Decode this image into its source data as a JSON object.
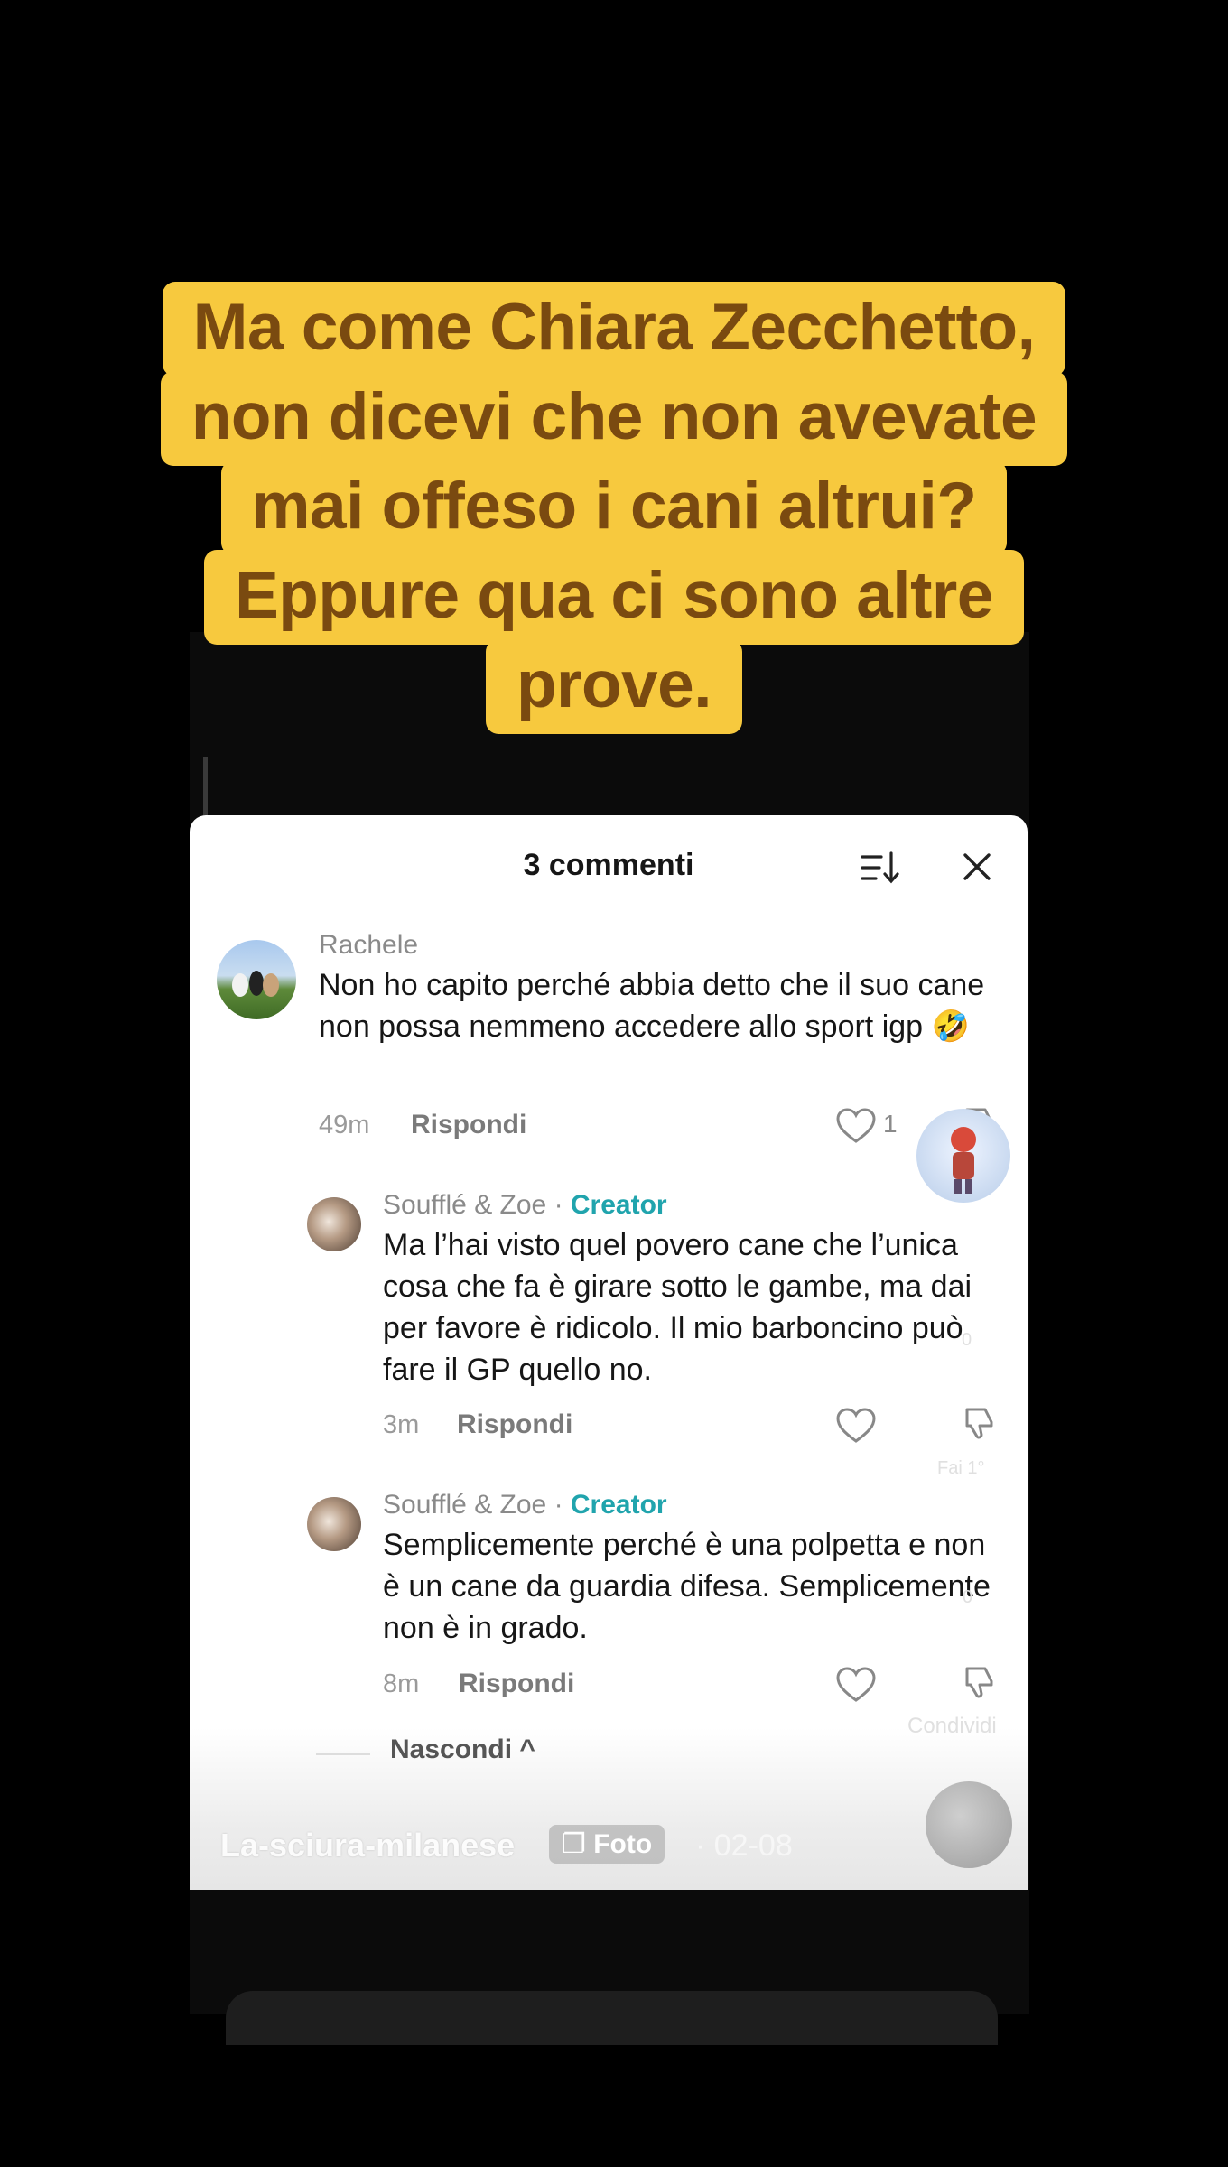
{
  "caption": {
    "lines": [
      "Ma come Chiara Zecchetto,",
      "non dicevi che non avevate",
      "mai offeso i cani altrui?",
      "Eppure qua ci sono altre",
      "prove."
    ]
  },
  "panel": {
    "title": "3 commenti",
    "sort_icon": "sort-icon",
    "close_icon": "close-icon"
  },
  "comments": [
    {
      "user": "Rachele",
      "creator_label": "",
      "text": "Non ho capito perché abbia detto che il suo cane non possa nemmeno accedere allo sport igp 🤣",
      "time": "49m",
      "reply": "Rispondi",
      "likes": "1"
    },
    {
      "user": "Soufflé & Zoe · ",
      "creator_label": "Creator",
      "text": "Ma l’hai visto quel povero cane che l’unica cosa che fa è girare sotto le gambe, ma dai per favore è ridicolo. Il mio barboncino può fare il GP quello no.",
      "time": "3m",
      "reply": "Rispondi",
      "likes": ""
    },
    {
      "user": "Soufflé & Zoe · ",
      "creator_label": "Creator",
      "text": "Semplicemente perché è una polpetta e non è un cane da guardia difesa. Semplicemente non è in grado.",
      "time": "8m",
      "reply": "Rispondi",
      "likes": ""
    }
  ],
  "hide_label": "Nascondi ^",
  "footer": {
    "author": "La-sciura-milanese",
    "badge": "Foto",
    "date": "· 02-08"
  },
  "side_faint": {
    "likes_count": "0",
    "pin": "Fai 1°",
    "comments_count": "0",
    "share": "Condividi"
  }
}
